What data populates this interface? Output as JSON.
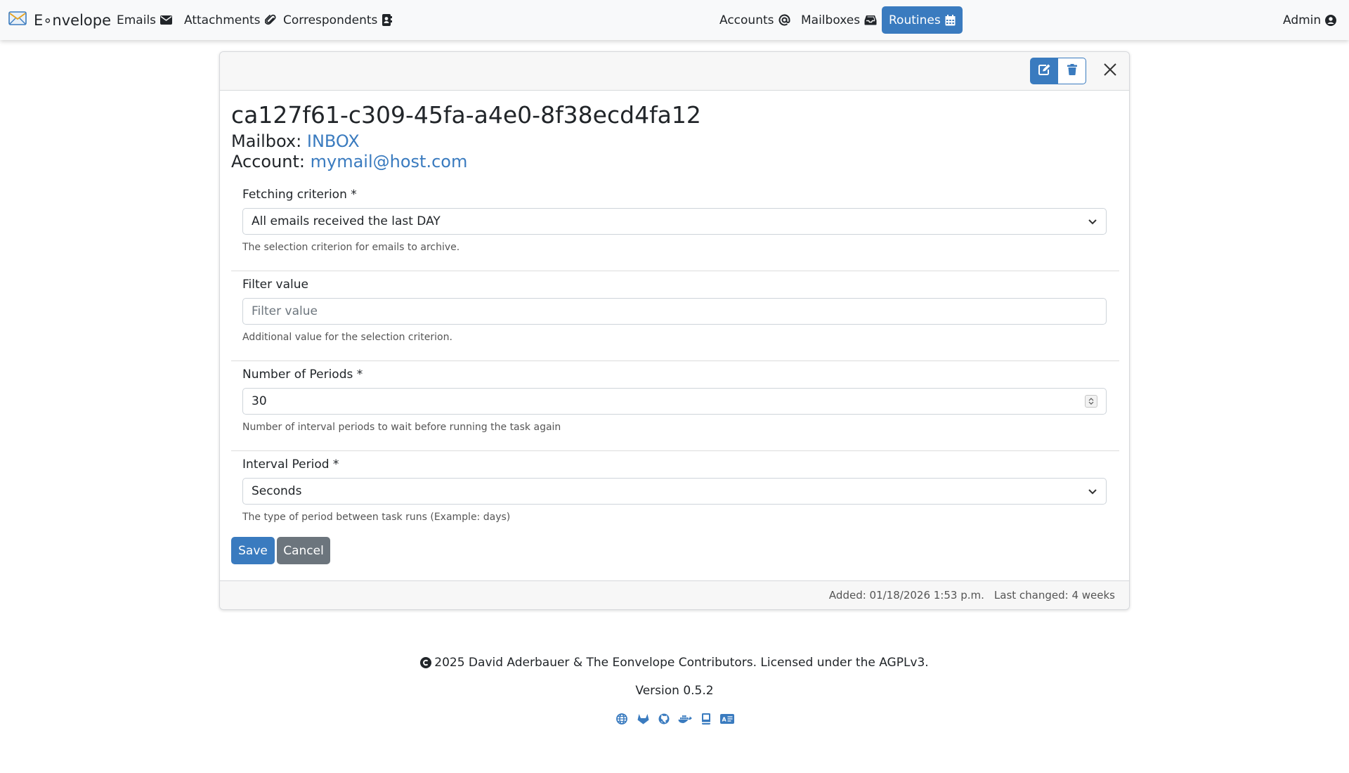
{
  "nav": {
    "brand": "E∘nvelope",
    "left_links": [
      {
        "label": "Emails",
        "icon": "envelope-icon"
      },
      {
        "label": "Attachments",
        "icon": "paperclip-icon"
      },
      {
        "label": "Correspondents",
        "icon": "contact-card-icon"
      }
    ],
    "right_links": [
      {
        "label": "Accounts",
        "icon": "at-icon"
      },
      {
        "label": "Mailboxes",
        "icon": "inbox-icon"
      },
      {
        "label": "Routines",
        "icon": "calendar-icon",
        "active": true
      }
    ],
    "user": {
      "label": "Admin",
      "icon": "user-circle-icon"
    }
  },
  "routine": {
    "title": "ca127f61-c309-45fa-a4e0-8f38ecd4fa12",
    "mailbox_label": "Mailbox:",
    "mailbox_value": "INBOX",
    "account_label": "Account:",
    "account_value": "mymail@host.com"
  },
  "form": {
    "criterion": {
      "label": "Fetching criterion *",
      "value": "All emails received the last DAY",
      "help": "The selection criterion for emails to archive."
    },
    "filter": {
      "label": "Filter value",
      "placeholder": "Filter value",
      "value": "",
      "help": "Additional value for the selection criterion."
    },
    "periods": {
      "label": "Number of Periods *",
      "value": "30",
      "help": "Number of interval periods to wait before running the task again"
    },
    "interval": {
      "label": "Interval Period *",
      "value": "Seconds",
      "help": "The type of period between task runs (Example: days)"
    },
    "save_label": "Save",
    "cancel_label": "Cancel"
  },
  "card_footer": {
    "added": "Added: 01/18/2026 1:53 p.m.",
    "last_changed": "Last changed: 4 weeks"
  },
  "page_footer": {
    "copyright": "2025 David Aderbauer & The Eonvelope Contributors. Licensed under the AGPLv3.",
    "version": "Version 0.5.2",
    "icons": [
      "globe-icon",
      "gitlab-icon",
      "github-icon",
      "docker-icon",
      "book-icon",
      "id-card-icon"
    ]
  },
  "colors": {
    "primary": "#3a7bbf",
    "secondary": "#6c757d",
    "navbar_bg": "#f8f9fa"
  }
}
